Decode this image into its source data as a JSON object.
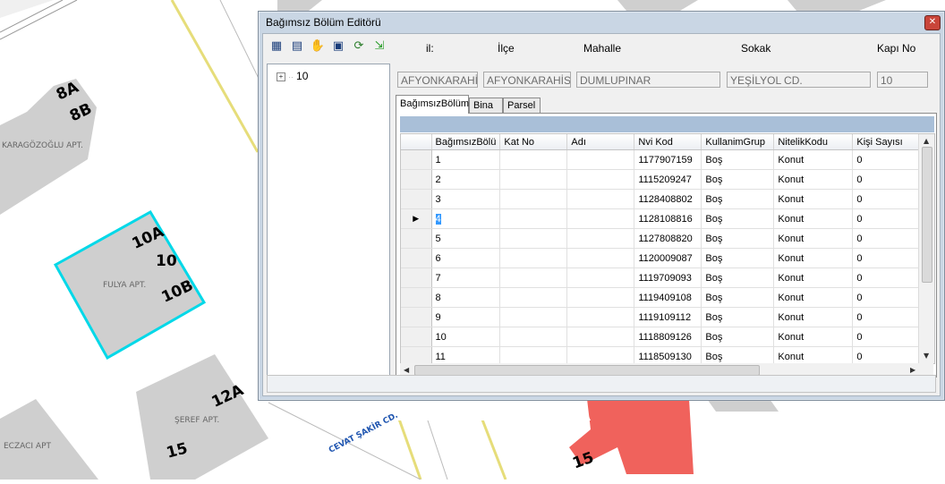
{
  "map": {
    "labels": [
      "KARAGÖZOĞLU APT.",
      "FULYA APT.",
      "ŞEREF APT.",
      "ECZACI APT"
    ],
    "addresses": [
      "8A",
      "8B",
      "10A",
      "10",
      "10B",
      "12A",
      "15",
      "15"
    ],
    "street": "CEVAT ŞAKİR CD."
  },
  "window": {
    "title": "Bağımsız Bölüm Editörü",
    "close_icon": "close-icon",
    "toolbar_icons": [
      "grid-add-icon",
      "grid-edit-icon",
      "hand-icon",
      "save-icon",
      "refresh-icon",
      "export-icon"
    ]
  },
  "tree": {
    "root_label": "10"
  },
  "address": {
    "headers": {
      "il": "il:",
      "ilce": "İlçe",
      "mahalle": "Mahalle",
      "sokak": "Sokak",
      "kapi": "Kapı No"
    },
    "values": {
      "il": "AFYONKARAHİSAR",
      "ilce": "AFYONKARAHİSAR",
      "mahalle": "DUMLUPINAR",
      "sokak": "YEŞİLYOL CD.",
      "kapi": "10"
    }
  },
  "tabs": [
    "BağımsızBölüm",
    "Bina",
    "Parsel"
  ],
  "grid": {
    "columns": [
      "BağımsızBölü",
      "Kat No",
      "Adı",
      "Nvi Kod",
      "KullanimGrup",
      "NitelikKodu",
      "Kişi Sayısı"
    ],
    "rows": [
      {
        "no": "1",
        "nvi": "1177907159",
        "grup": "Boş",
        "nitelik": "Konut",
        "kisi": "0"
      },
      {
        "no": "2",
        "nvi": "1115209247",
        "grup": "Boş",
        "nitelik": "Konut",
        "kisi": "0"
      },
      {
        "no": "3",
        "nvi": "1128408802",
        "grup": "Boş",
        "nitelik": "Konut",
        "kisi": "0"
      },
      {
        "no": "4",
        "nvi": "1128108816",
        "grup": "Boş",
        "nitelik": "Konut",
        "kisi": "0"
      },
      {
        "no": "5",
        "nvi": "1127808820",
        "grup": "Boş",
        "nitelik": "Konut",
        "kisi": "0"
      },
      {
        "no": "6",
        "nvi": "1120009087",
        "grup": "Boş",
        "nitelik": "Konut",
        "kisi": "0"
      },
      {
        "no": "7",
        "nvi": "1119709093",
        "grup": "Boş",
        "nitelik": "Konut",
        "kisi": "0"
      },
      {
        "no": "8",
        "nvi": "1119409108",
        "grup": "Boş",
        "nitelik": "Konut",
        "kisi": "0"
      },
      {
        "no": "9",
        "nvi": "1119109112",
        "grup": "Boş",
        "nitelik": "Konut",
        "kisi": "0"
      },
      {
        "no": "10",
        "nvi": "1118809126",
        "grup": "Boş",
        "nitelik": "Konut",
        "kisi": "0"
      },
      {
        "no": "11",
        "nvi": "1118509130",
        "grup": "Boş",
        "nitelik": "Konut",
        "kisi": "0"
      }
    ],
    "selected_row": 3
  },
  "colors": {
    "highlight": "#00d8e8",
    "parcel_red": "#f0625c",
    "road": "#e6dd7a",
    "building": "#cfcfcf"
  }
}
